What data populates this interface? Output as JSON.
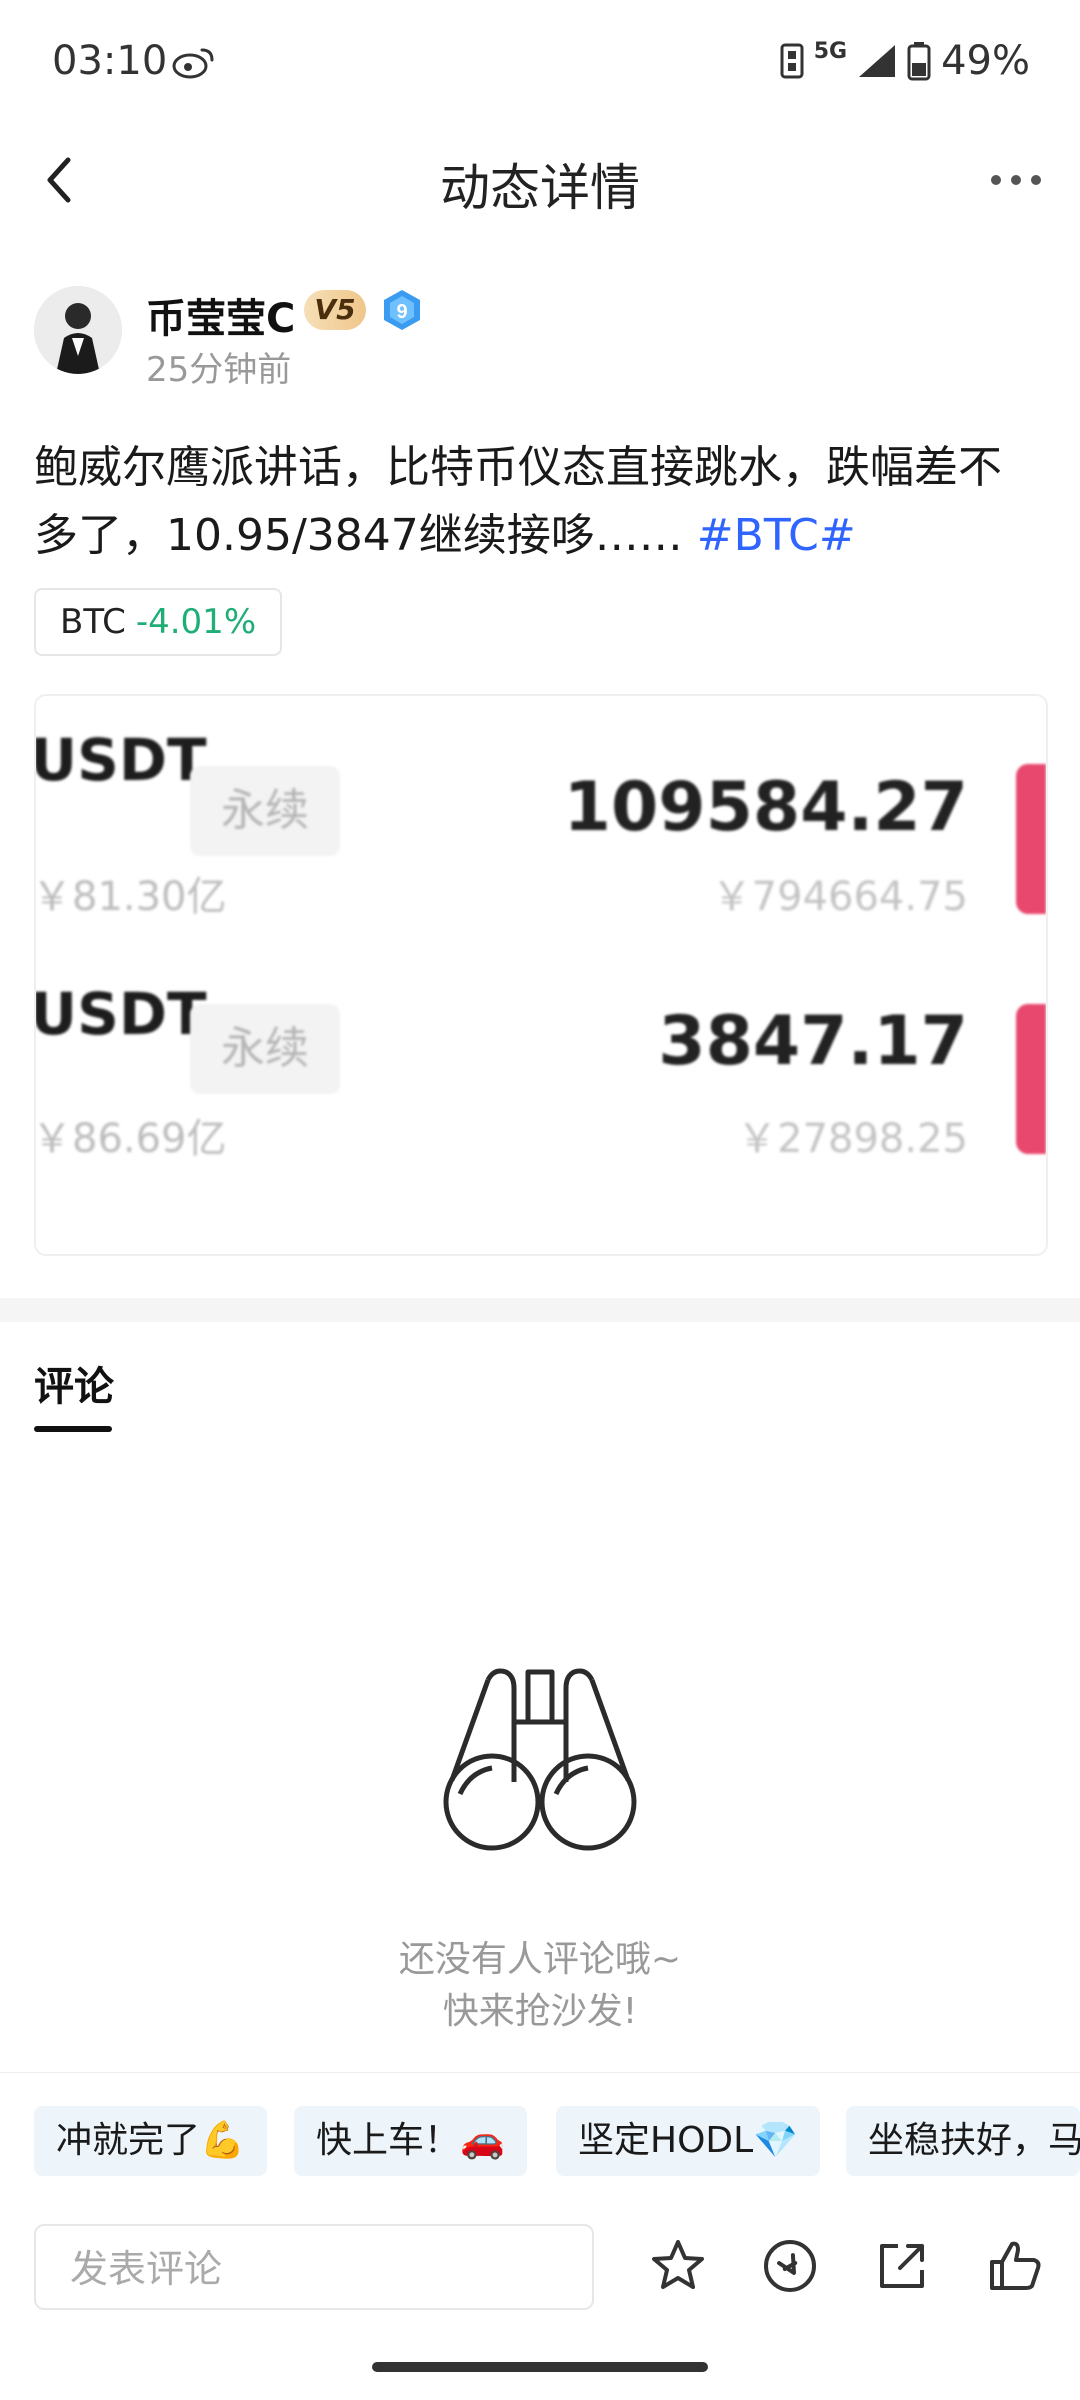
{
  "status_bar": {
    "time": "03:10",
    "network": "5G",
    "battery": "49%"
  },
  "header": {
    "title": "动态详情"
  },
  "post": {
    "author": "币莹莹C",
    "vip_badge": "V5",
    "level_badge": "9",
    "time_ago": "25分钟前",
    "text": "鲍威尔鹰派讲话，比特币仪态直接跳水，跌幅差不多了，10.95/3847继续接哆……",
    "hashtag": "#BTC#",
    "ticker": {
      "symbol": "BTC",
      "change": "-4.01%"
    }
  },
  "image_card": {
    "rows": [
      {
        "pair": "USDT",
        "tag": "永续",
        "volume": "￥81.30亿",
        "price": "109584.27",
        "cny": "￥794664.75"
      },
      {
        "pair": "USDT",
        "tag": "永续",
        "volume": "￥86.69亿",
        "price": "3847.17",
        "cny": "￥27898.25"
      }
    ]
  },
  "comments": {
    "tab_label": "评论",
    "empty_line1": "还没有人评论哦~",
    "empty_line2": "快来抢沙发!"
  },
  "quick_replies": [
    "冲就完了💪",
    "快上车！🚗",
    "坚定HODL💎",
    "坐稳扶好，马"
  ],
  "bottom_bar": {
    "input_placeholder": "发表评论",
    "icons": [
      "star-icon",
      "tip-coin-icon",
      "share-icon",
      "like-icon"
    ]
  },
  "colors": {
    "accent": "#2f64ff",
    "positive": "#1fae76",
    "price_bar": "#e8486e"
  }
}
